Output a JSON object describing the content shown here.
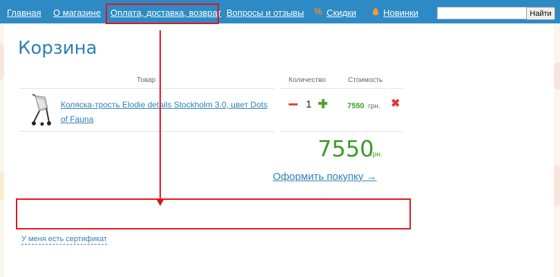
{
  "nav": {
    "items": [
      {
        "label": "Главная"
      },
      {
        "label": "О магазине"
      },
      {
        "label": "Оплата, доставка, возврат"
      },
      {
        "label": "Вопросы и отзывы"
      },
      {
        "label": "Скидки",
        "icon": "percent-icon"
      },
      {
        "label": "Новинки",
        "icon": "new-items-icon"
      }
    ],
    "percent_glyph": "%",
    "search": {
      "value": "",
      "button_label": "Найти"
    }
  },
  "cart": {
    "title": "Корзина",
    "columns": {
      "product": "Товар",
      "quantity": "Количество",
      "cost": "Стоимость"
    },
    "items": [
      {
        "name": "Коляска-трость Elodie details Stockholm 3.0, цвет Dots of Fauna",
        "minus_glyph": "—",
        "quantity": "1",
        "price": "7550",
        "currency": "грн.",
        "image_icon": "stroller-icon"
      }
    ],
    "total": {
      "value": "7550",
      "currency": "грн."
    },
    "checkout_label": "Оформить покупку →",
    "certificate_label": "У меня есть сертификат"
  },
  "colors": {
    "nav_bar": "#2d8ac4",
    "link": "#2d7fb8",
    "price_green": "#3a9a2a",
    "annotation_red": "#e0141b"
  },
  "annotations": {
    "type": "red-rectangles-and-arrow"
  }
}
